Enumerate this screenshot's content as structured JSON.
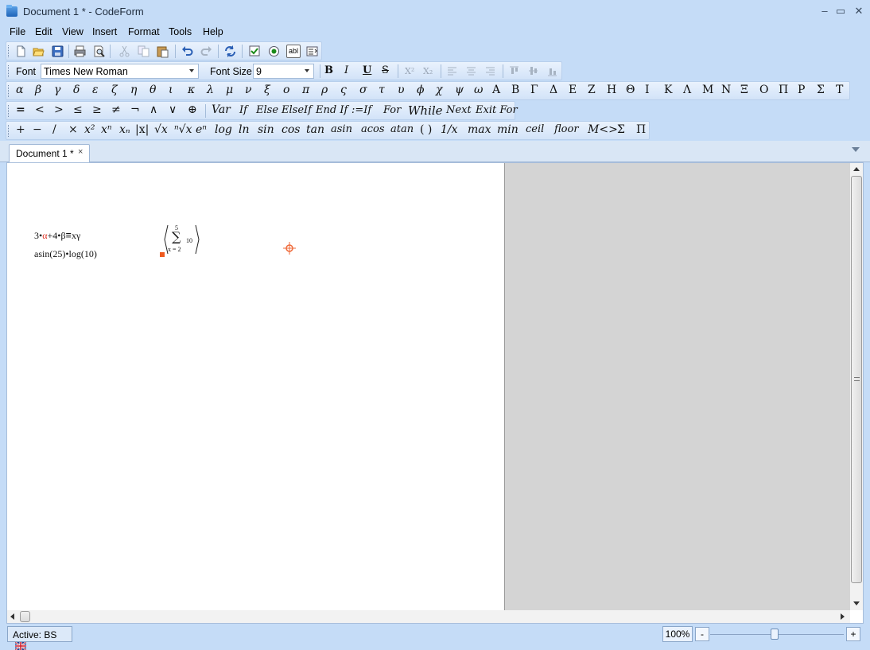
{
  "window": {
    "title": "Document 1 * - CodeForm",
    "controls": {
      "minimize": "–",
      "maximize": "▭",
      "close": "✕"
    }
  },
  "menu": [
    "File",
    "Edit",
    "View",
    "Insert",
    "Format",
    "Tools",
    "Help"
  ],
  "standard_toolbar": {
    "icons": [
      "new-icon",
      "open-icon",
      "save-icon",
      "print-icon",
      "print-preview-icon",
      "cut-icon",
      "copy-icon",
      "paste-icon",
      "undo-icon",
      "redo-icon",
      "refresh-icon",
      "checkbox-icon",
      "radio-icon",
      "textbox-icon",
      "list-icon"
    ],
    "textbox_label": "abl"
  },
  "format_toolbar": {
    "font_label": "Font",
    "font_value": "Times New Roman",
    "size_label": "Font Size",
    "size_value": "9",
    "bold": "B",
    "italic": "I",
    "underline": "U",
    "strike": "S",
    "superscript": "X²",
    "subscript": "X₂"
  },
  "greek_toolbar": {
    "lower": [
      "α",
      "β",
      "γ",
      "δ",
      "ε",
      "ζ",
      "η",
      "θ",
      "ι",
      "κ",
      "λ",
      "μ",
      "ν",
      "ξ",
      "ο",
      "π",
      "ρ",
      "ς",
      "σ",
      "τ",
      "υ",
      "ϕ",
      "χ",
      "ψ",
      "ω"
    ],
    "upper": [
      "Α",
      "Β",
      "Γ",
      "Δ",
      "Ε",
      "Ζ",
      "Η",
      "Θ",
      "Ι",
      "Κ",
      "Λ",
      "Μ",
      "Ν",
      "Ξ",
      "Ο",
      "Π",
      "Ρ",
      "Σ",
      "Τ"
    ]
  },
  "logic_toolbar": {
    "operators": [
      "=",
      "<",
      ">",
      "≤",
      "≥",
      "≠",
      "¬",
      "∧",
      "∨",
      "⊕"
    ],
    "keywords": [
      "Var",
      "If",
      "Else",
      "ElseIf",
      "End If",
      ":=If",
      "For",
      "While",
      "Next",
      "Exit For"
    ]
  },
  "function_toolbar": {
    "items": [
      "+",
      "−",
      "/",
      "×",
      "x²",
      "xⁿ",
      "xₙ",
      "|x|",
      "√x",
      "ⁿ√x",
      "eⁿ",
      "log",
      "ln",
      "sin",
      "cos",
      "tan",
      "asin",
      "acos",
      "atan",
      "( )",
      "1/x",
      "max",
      "min",
      "ceil",
      "floor",
      "M<>",
      "Σ",
      "Π"
    ]
  },
  "tabs": [
    {
      "label": "Document 1 *",
      "close": "×"
    }
  ],
  "document": {
    "line1": [
      "3•",
      "α",
      "+4•β",
      "≡",
      "xγ"
    ],
    "line2": "asin(25)•log(10)",
    "sum": {
      "upper": "5",
      "symbol": "∑",
      "lower": "x = 2",
      "value": "10"
    }
  },
  "status": {
    "active_label": "Active: BS",
    "zoom": "100%",
    "zoom_minus": "-",
    "zoom_plus": "+",
    "zoom_level": 0.48
  }
}
